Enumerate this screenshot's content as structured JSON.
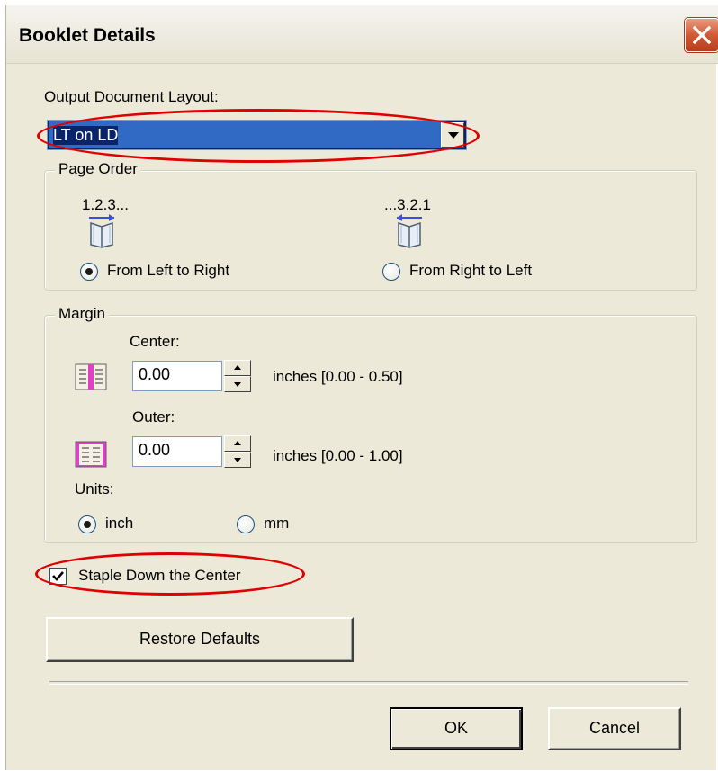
{
  "window": {
    "title": "Booklet Details",
    "close_icon": "close-x-icon"
  },
  "output_layout": {
    "label": "Output Document Layout:",
    "selected": "LT on LD"
  },
  "page_order": {
    "group_label": "Page Order",
    "left_to_right": {
      "sequence": "1.2.3...",
      "label": "From Left to Right",
      "checked": true,
      "icon": "booklet-left-to-right-icon"
    },
    "right_to_left": {
      "sequence": "...3.2.1",
      "label": "From Right to Left",
      "checked": false,
      "icon": "booklet-right-to-left-icon"
    }
  },
  "margin": {
    "group_label": "Margin",
    "center": {
      "label": "Center:",
      "value": "0.00",
      "range": "inches [0.00 - 0.50]",
      "icon": "center-margin-icon"
    },
    "outer": {
      "label": "Outer:",
      "value": "0.00",
      "range": "inches [0.00 - 1.00]",
      "icon": "outer-margin-icon"
    },
    "units": {
      "label": "Units:",
      "inch": {
        "label": "inch",
        "checked": true
      },
      "mm": {
        "label": "mm",
        "checked": false
      }
    }
  },
  "staple": {
    "label": "Staple Down the Center",
    "checked": true
  },
  "buttons": {
    "restore_defaults": "Restore Defaults",
    "ok": "OK",
    "cancel": "Cancel"
  },
  "colors": {
    "dialog_bg": "#ece9d8",
    "selection": "#316ac5",
    "highlight_annotation": "#e00000",
    "margin_accent": "#e040c8",
    "arrow_accent": "#3a4fe0"
  }
}
